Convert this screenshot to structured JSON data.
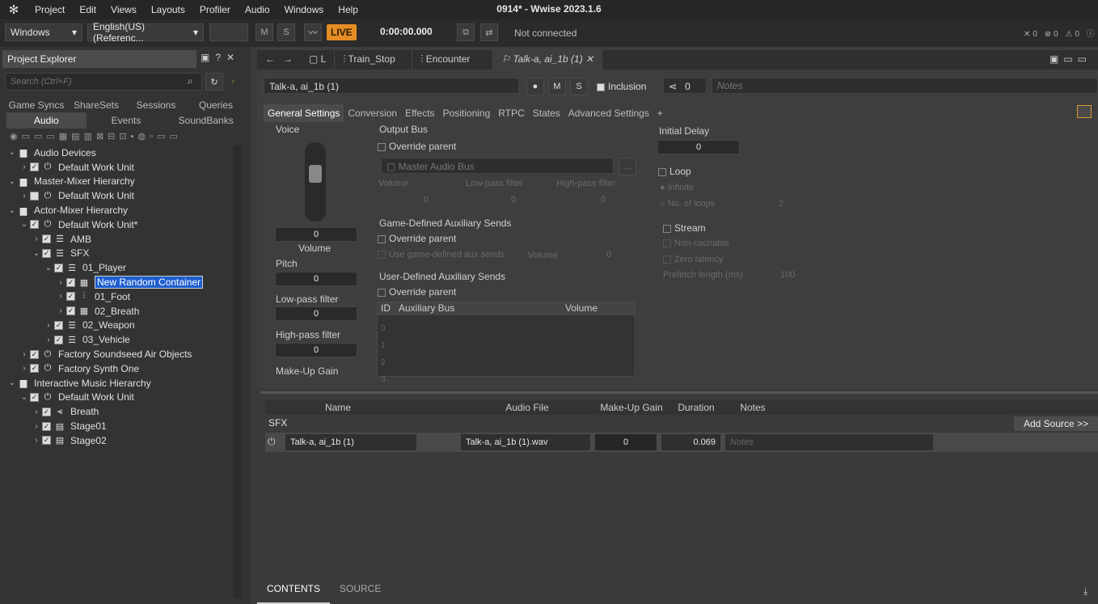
{
  "menu": {
    "logo": "wwise-icon",
    "items": [
      "Project",
      "Edit",
      "Views",
      "Layouts",
      "Profiler",
      "Audio",
      "Windows",
      "Help"
    ]
  },
  "app_title": "0914* - Wwise 2023.1.6",
  "toolbar": {
    "platform": "Windows",
    "language": "English(US) (Referenc...",
    "mute": "M",
    "solo": "S",
    "live": "LIVE",
    "time": "0:00:00.000",
    "connection": "Not connected"
  },
  "explorer": {
    "title": "Project Explorer",
    "search_placeholder": "Search (Ctrl+F)",
    "tabs1": [
      "Game Syncs",
      "ShareSets",
      "Sessions",
      "Queries"
    ],
    "tabs2": [
      "Audio",
      "Events",
      "SoundBanks"
    ],
    "tree": [
      {
        "label": "Audio Devices",
        "level": 0,
        "arrow": "v",
        "checked": false,
        "icon": "folder"
      },
      {
        "label": "Default Work Unit",
        "level": 1,
        "arrow": ">",
        "checked": true,
        "icon": "workunit"
      },
      {
        "label": "Master-Mixer Hierarchy",
        "level": 0,
        "arrow": "v",
        "checked": false,
        "icon": "folder"
      },
      {
        "label": "Default Work Unit",
        "level": 1,
        "arrow": ">",
        "checked": false,
        "icon": "workunit"
      },
      {
        "label": "Actor-Mixer Hierarchy",
        "level": 0,
        "arrow": "v",
        "checked": false,
        "icon": "folder"
      },
      {
        "label": "Default Work Unit*",
        "level": 1,
        "arrow": "v",
        "checked": true,
        "icon": "workunit"
      },
      {
        "label": "AMB",
        "level": 2,
        "arrow": ">",
        "checked": true,
        "icon": "actor-mixer"
      },
      {
        "label": "SFX",
        "level": 2,
        "arrow": "v",
        "checked": true,
        "icon": "actor-mixer"
      },
      {
        "label": "01_Player",
        "level": 3,
        "arrow": "v",
        "checked": true,
        "icon": "actor-mixer"
      },
      {
        "label": "New Random Container",
        "level": 4,
        "arrow": ">",
        "checked": true,
        "icon": "random-container",
        "selected": true
      },
      {
        "label": "01_Foot",
        "level": 4,
        "arrow": ">",
        "checked": true,
        "icon": "switch-container"
      },
      {
        "label": "02_Breath",
        "level": 4,
        "arrow": ">",
        "checked": true,
        "icon": "random-container"
      },
      {
        "label": "02_Weapon",
        "level": 3,
        "arrow": ">",
        "checked": true,
        "icon": "actor-mixer"
      },
      {
        "label": "03_Vehicle",
        "level": 3,
        "arrow": ">",
        "checked": true,
        "icon": "actor-mixer"
      },
      {
        "label": "Factory Soundseed Air Objects",
        "level": 1,
        "arrow": ">",
        "checked": true,
        "icon": "workunit"
      },
      {
        "label": "Factory Synth One",
        "level": 1,
        "arrow": ">",
        "checked": true,
        "icon": "workunit"
      },
      {
        "label": "Interactive Music Hierarchy",
        "level": 0,
        "arrow": "v",
        "checked": false,
        "icon": "folder"
      },
      {
        "label": "Default Work Unit",
        "level": 1,
        "arrow": "v",
        "checked": true,
        "icon": "workunit"
      },
      {
        "label": "Breath",
        "level": 2,
        "arrow": ">",
        "checked": true,
        "icon": "music-switch"
      },
      {
        "label": "Stage01",
        "level": 2,
        "arrow": ">",
        "checked": true,
        "icon": "music-playlist"
      },
      {
        "label": "Stage02",
        "level": 2,
        "arrow": ">",
        "checked": true,
        "icon": "music-playlist"
      }
    ]
  },
  "nav_tabs": [
    "L",
    "Train_Stop",
    "Encounter",
    "Talk-a, ai_1b (1)"
  ],
  "editor": {
    "name": "Talk-a, ai_1b (1)",
    "mute": "M",
    "solo": "S",
    "inclusion": "Inclusion",
    "share_count": "0",
    "notes_placeholder": "Notes",
    "tabs": [
      "General Settings",
      "Conversion",
      "Effects",
      "Positioning",
      "RTPC",
      "States",
      "Advanced Settings",
      "+"
    ],
    "voice": "Voice",
    "volume_value": "0",
    "volume_label": "Volume",
    "pitch": "Pitch",
    "pitch_value": "0",
    "lowpass": "Low-pass filter",
    "lowpass_value": "0",
    "highpass": "High-pass filter",
    "highpass_value": "0",
    "makeup": "Make-Up Gain",
    "output_bus": "Output Bus",
    "override_parent": "Override parent",
    "master_bus": "Master Audio Bus",
    "bus_volume": "Volume",
    "bus_lowpass": "Low-pass filter",
    "bus_highpass": "High-pass filter",
    "bus_zero": "0",
    "game_aux": "Game-Defined Auxiliary Sends",
    "use_game_aux": "Use game-defined aux sends",
    "aux_volume": "Volume",
    "user_aux": "User-Defined Auxiliary Sends",
    "aux_cols": [
      "ID",
      "Auxiliary Bus",
      "Volume"
    ],
    "aux_ids": [
      "0",
      "1",
      "2",
      "3"
    ],
    "initial_delay": "Initial Delay",
    "initial_delay_value": "0",
    "loop": "Loop",
    "infinite": "Infinite",
    "num_loops": "No. of loops",
    "loops_value": "2",
    "stream": "Stream",
    "non_cachable": "Non-cachable",
    "zero_latency": "Zero latency",
    "prefetch": "Prefetch length (ms)",
    "prefetch_value": "100"
  },
  "contents": {
    "cols": [
      "Name",
      "Audio File",
      "Make-Up Gain",
      "Duration",
      "Notes"
    ],
    "group": "SFX",
    "add_source": "Add Source >>",
    "row": {
      "name": "Talk-a, ai_1b (1)",
      "file": "Talk-a, ai_1b (1).wav",
      "gain": "0",
      "duration": "0.069",
      "notes": "Notes"
    }
  },
  "bottom_tabs": [
    "CONTENTS",
    "SOURCE"
  ]
}
